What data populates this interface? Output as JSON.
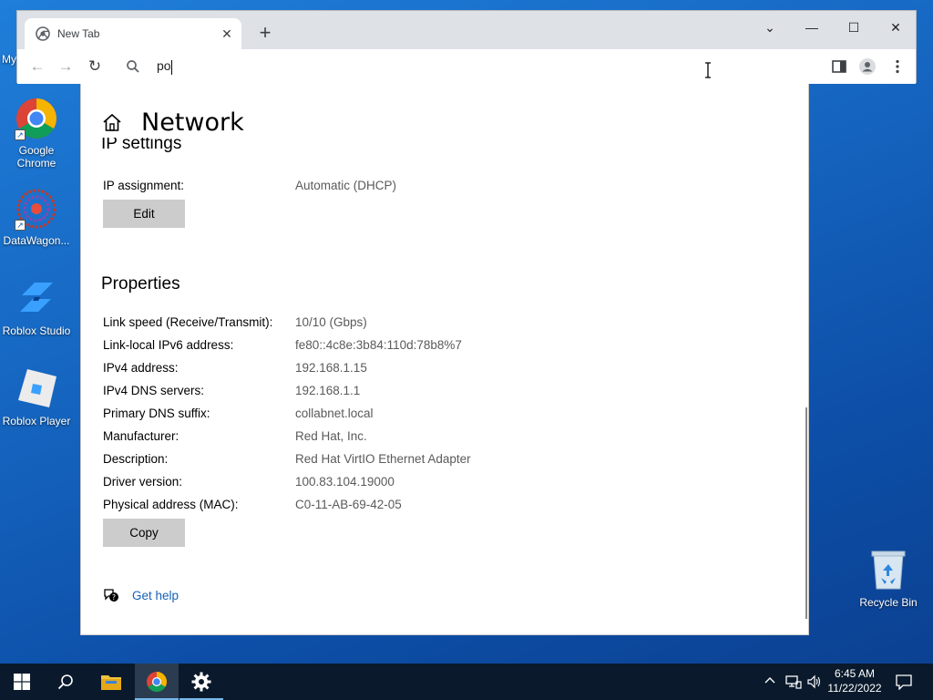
{
  "desktop": {
    "partial_label": "My",
    "icons": [
      {
        "label": "Google Chrome"
      },
      {
        "label": "DataWagon..."
      },
      {
        "label": "Roblox Studio"
      },
      {
        "label": "Roblox Player"
      },
      {
        "label": "Recycle Bin"
      }
    ]
  },
  "browser": {
    "tab_title": "New Tab",
    "tab_close": "✕",
    "new_tab": "+",
    "omnibox_value": "po",
    "window_controls": {
      "dropdown": "⌄",
      "minimize": "—",
      "maximize": "☐",
      "close": "✕"
    }
  },
  "settings": {
    "page_title": "Network",
    "ip_section_title": "IP settings",
    "ip_assignment_label": "IP assignment:",
    "ip_assignment_value": "Automatic (DHCP)",
    "edit_button": "Edit",
    "properties_title": "Properties",
    "properties": [
      {
        "label": "Link speed (Receive/Transmit):",
        "value": "10/10 (Gbps)"
      },
      {
        "label": "Link-local IPv6 address:",
        "value": "fe80::4c8e:3b84:110d:78b8%7"
      },
      {
        "label": "IPv4 address:",
        "value": "192.168.1.15"
      },
      {
        "label": "IPv4 DNS servers:",
        "value": "192.168.1.1"
      },
      {
        "label": "Primary DNS suffix:",
        "value": "collabnet.local"
      },
      {
        "label": "Manufacturer:",
        "value": "Red Hat, Inc."
      },
      {
        "label": "Description:",
        "value": "Red Hat VirtIO Ethernet Adapter"
      },
      {
        "label": "Driver version:",
        "value": "100.83.104.19000"
      },
      {
        "label": "Physical address (MAC):",
        "value": "C0-11-AB-69-42-05"
      }
    ],
    "copy_button": "Copy",
    "get_help": "Get help"
  },
  "taskbar": {
    "time": "6:45 AM",
    "date": "11/22/2022"
  },
  "colors": {
    "desktop": "#1565c0",
    "taskbar": "#0a1a2c",
    "link": "#1462b8",
    "button": "#cccccc"
  }
}
